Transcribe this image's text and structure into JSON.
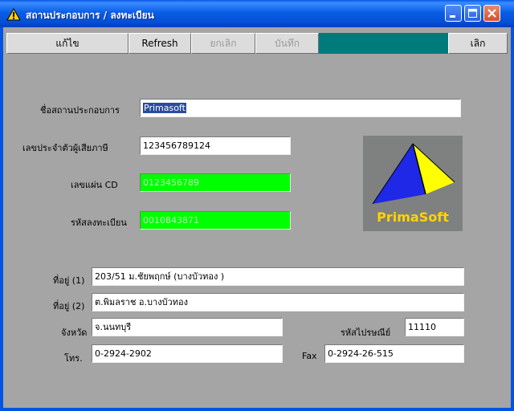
{
  "window": {
    "title": "สถานประกอบการ / ลงทะเบียน"
  },
  "toolbar": {
    "edit_label": "แก้ไข",
    "refresh_label": "Refresh",
    "cancel_label": "ยกเลิก",
    "save_label": "บันทึก",
    "exit_label": "เลิก"
  },
  "form": {
    "company_name": {
      "label": "ชื่อสถานประกอบการ",
      "value": "Primasoft"
    },
    "tax_id": {
      "label": "เลขประจำตัวผู้เสียภาษี",
      "value": "123456789124"
    },
    "cd_number": {
      "label": "เลขแผ่น CD",
      "value": "0123456789"
    },
    "registration_code": {
      "label": "รหัสลงทะเบียน",
      "value": "0010843871"
    },
    "address1": {
      "label": "ที่อยู่ (1)",
      "value": "203/51 ม.ชัยพฤกษ์ (บางบัวทอง )"
    },
    "address2": {
      "label": "ที่อยู่ (2)",
      "value": "ต.พิมลราช  อ.บางบัวทอง"
    },
    "province": {
      "label": "จังหวัด",
      "value": "จ.นนทบุรี"
    },
    "postal_code": {
      "label": "รหัสไปรษณีย์",
      "value": "11110"
    },
    "phone": {
      "label": "โทร.",
      "value": "0-2924-2902"
    },
    "fax": {
      "label": "Fax",
      "value": "0-2924-26-515"
    }
  },
  "logo": {
    "text": "PrimaSoft"
  },
  "colors": {
    "titlebar": "#0a5ee6",
    "client_bg": "#a5a5a5",
    "toolbar_bg": "#007b7b",
    "readonly_field": "#00ff00",
    "logo_bg": "#7f8080",
    "logo_text": "#ffd400",
    "pyramid_blue": "#1e28e6",
    "pyramid_yellow": "#ffff00"
  },
  "icons": {
    "app": "warning-triangle-icon",
    "minimize": "minimize-icon",
    "maximize": "maximize-icon",
    "close": "close-icon",
    "logo": "pyramid-icon"
  }
}
